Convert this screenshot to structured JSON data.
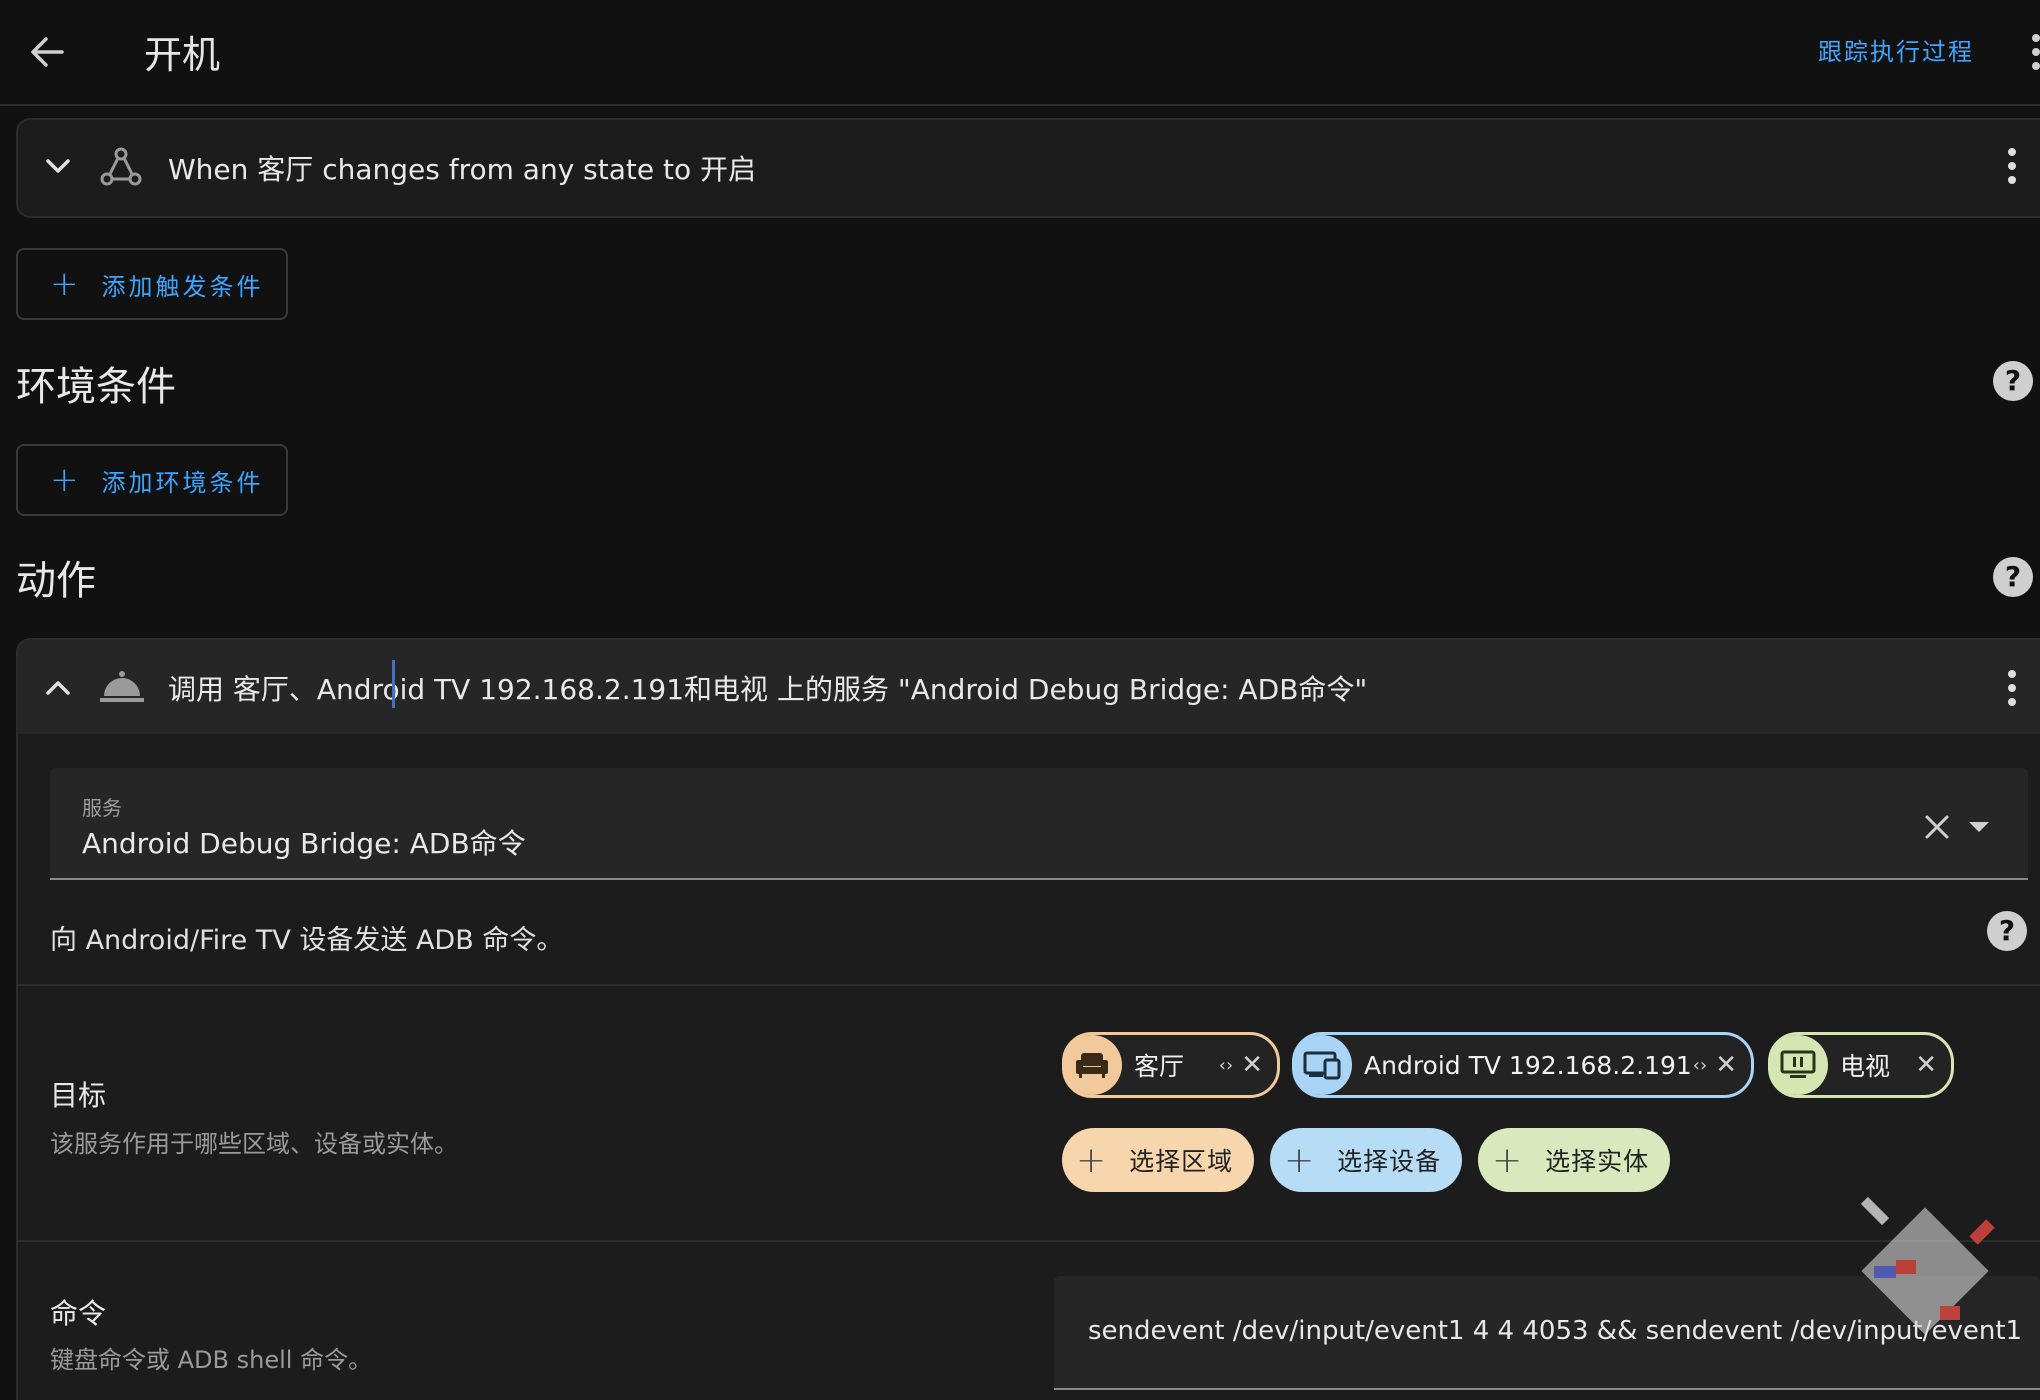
{
  "header": {
    "title": "开机",
    "trace_link": "跟踪执行过程"
  },
  "trigger": {
    "text": "When 客厅 changes from any state to 开启"
  },
  "add_trigger_label": "添加触发条件",
  "conditions": {
    "title": "环境条件",
    "add_label": "添加环境条件"
  },
  "actions": {
    "title": "动作",
    "card": {
      "header_text": "调用 客厅、Android TV 192.168.2.191和电视 上的服务 \"Android Debug Bridge: ADB命令\"",
      "service": {
        "label": "服务",
        "value": "Android Debug Bridge: ADB命令"
      },
      "description": "向 Android/Fire TV 设备发送 ADB 命令。",
      "target": {
        "label": "目标",
        "description": "该服务作用于哪些区域、设备或实体。",
        "chips": [
          {
            "label": "客厅",
            "color": "#f2c99a"
          },
          {
            "label": "Android TV 192.168.2.191",
            "color": "#a9d4f5"
          },
          {
            "label": "电视",
            "color": "#d6e6b3"
          }
        ],
        "add_buttons": [
          {
            "label": "选择区域",
            "color": "#f7d6ad"
          },
          {
            "label": "选择设备",
            "color": "#b7dcf6"
          },
          {
            "label": "选择实体",
            "color": "#d9e9bd"
          }
        ]
      },
      "command": {
        "label": "命令",
        "description": "键盘命令或 ADB shell 命令。",
        "value": "sendevent /dev/input/event1 4 4 4053 && sendevent /dev/input/event1"
      }
    }
  },
  "colors": {
    "accent": "#3ea4ff",
    "background": "#111111",
    "card": "#1c1c1c"
  }
}
